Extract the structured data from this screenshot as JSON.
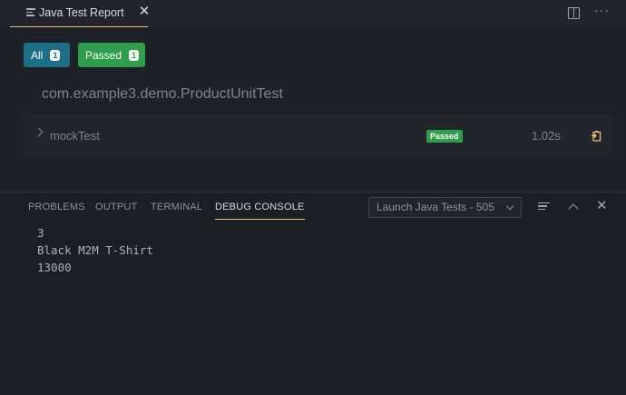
{
  "editor": {
    "tab_title": "Java Test Report",
    "tab_icon": "preview-icon",
    "close_glyph": "✕",
    "actions": [
      "split-editor-icon",
      "more-actions-icon"
    ],
    "more_glyph": "···"
  },
  "report": {
    "filters": [
      {
        "label": "All",
        "count": "1"
      },
      {
        "label": "Passed",
        "count": "1"
      }
    ],
    "suite": "com.example3.demo.ProductUnitTest",
    "tests": [
      {
        "name": "mockTest",
        "status": "Passed",
        "duration": "1.02s"
      }
    ],
    "colors": {
      "accent": "#1d6e87",
      "passed": "#2e9e4b",
      "tab_underline": "#e5c07b"
    }
  },
  "panel": {
    "tabs": [
      "PROBLEMS",
      "OUTPUT",
      "TERMINAL",
      "DEBUG CONSOLE"
    ],
    "active_tab": "DEBUG CONSOLE",
    "session": "Launch Java Tests - 505",
    "console_lines": [
      "3",
      "Black M2M T-Shirt",
      "13000"
    ]
  }
}
